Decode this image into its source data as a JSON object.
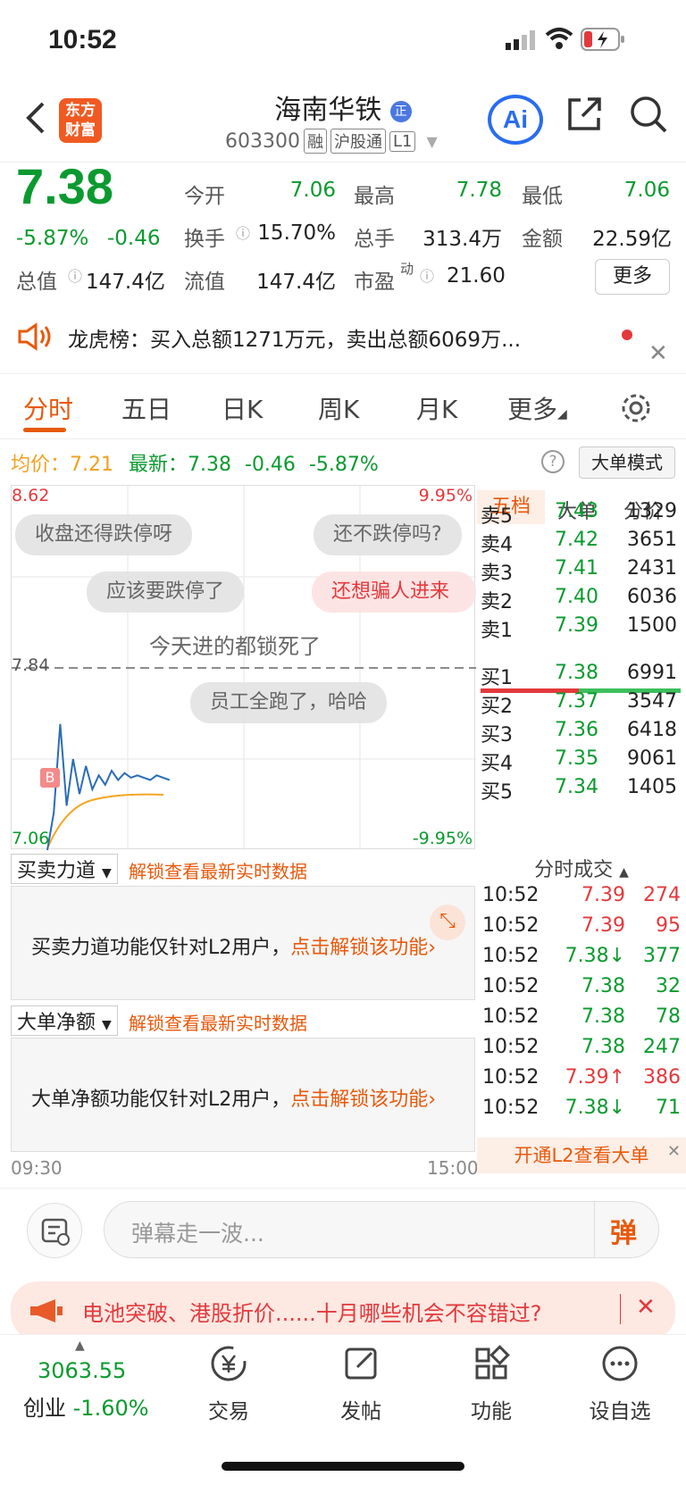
{
  "status": {
    "time": "10:52"
  },
  "header": {
    "logo": "东方财富",
    "stock_name": "海南华铁",
    "code": "603300",
    "tags": [
      "融",
      "沪股通",
      "L1"
    ],
    "ai_label": "Ai"
  },
  "quote": {
    "price": "7.38",
    "change_pct": "-5.87%",
    "change": "-0.46",
    "open_label": "今开",
    "open": "7.06",
    "high_label": "最高",
    "high": "7.78",
    "low_label": "最低",
    "low": "7.06",
    "turnover_label": "换手",
    "turnover": "15.70%",
    "volume_label": "总手",
    "volume": "313.4万",
    "amount_label": "金额",
    "amount": "22.59亿",
    "mktcap_label": "总值",
    "mktcap": "147.4亿",
    "float_label": "流值",
    "float": "147.4亿",
    "pe_label": "市盈",
    "pe_sup": "动",
    "pe": "21.60",
    "more": "更多"
  },
  "notice": {
    "text": "龙虎榜：买入总额1271万元，卖出总额6069万..."
  },
  "tabs": [
    "分时",
    "五日",
    "日K",
    "周K",
    "月K",
    "更多"
  ],
  "info": {
    "avg_label": "均价：",
    "avg": "7.21",
    "latest_label": "最新：",
    "latest": "7.38",
    "chg": "-0.46",
    "pct": "-5.87%",
    "bigmode": "大单模式"
  },
  "chart": {
    "y_max": "8.62",
    "y_min": "7.06",
    "pct_max": "9.95%",
    "pct_min": "-9.95%",
    "ref": "7.84",
    "t_start": "09:30",
    "t_end": "15:00",
    "marker": "B",
    "danmu": [
      "收盘还得跌停呀",
      "还不跌停吗?",
      "应该要跌停了",
      "还想骗人进来",
      "今天进的都锁死了",
      "员工全跑了，哈哈"
    ]
  },
  "chart_data": {
    "type": "line",
    "series": [
      {
        "values": [
          7.06,
          7.22,
          7.6,
          7.25,
          7.45,
          7.3,
          7.42,
          7.32,
          7.38,
          7.34,
          7.4,
          7.36,
          7.39,
          7.37,
          7.38,
          7.37,
          7.36,
          7.38,
          7.37,
          7.36
        ]
      }
    ],
    "ylim": [
      7.06,
      8.62
    ]
  },
  "book": {
    "tabs": [
      "五档",
      "大单",
      "分价"
    ],
    "sells": [
      {
        "l": "卖5",
        "p": "7.43",
        "v": "1329"
      },
      {
        "l": "卖4",
        "p": "7.42",
        "v": "3651"
      },
      {
        "l": "卖3",
        "p": "7.41",
        "v": "2431"
      },
      {
        "l": "卖2",
        "p": "7.40",
        "v": "6036"
      },
      {
        "l": "卖1",
        "p": "7.39",
        "v": "1500"
      }
    ],
    "buys": [
      {
        "l": "买1",
        "p": "7.38",
        "v": "6991"
      },
      {
        "l": "买2",
        "p": "7.37",
        "v": "3547"
      },
      {
        "l": "买3",
        "p": "7.36",
        "v": "6418"
      },
      {
        "l": "买4",
        "p": "7.35",
        "v": "9061"
      },
      {
        "l": "买5",
        "p": "7.34",
        "v": "1405"
      }
    ]
  },
  "panels": {
    "p1_select": "买卖力道",
    "p1_hint": "解锁查看最新实时数据",
    "p1_text": "买卖力道功能仅针对L2用户，",
    "p1_link": "点击解锁该功能",
    "p2_select": "大单净额",
    "p2_hint": "解锁查看最新实时数据",
    "p2_text": "大单净额功能仅针对L2用户，",
    "p2_link": "点击解锁该功能"
  },
  "trades": {
    "title": "分时成交",
    "rows": [
      {
        "t": "10:52",
        "p": "7.39",
        "v": "274",
        "c": "red",
        "a": ""
      },
      {
        "t": "10:52",
        "p": "7.39",
        "v": "95",
        "c": "red",
        "a": ""
      },
      {
        "t": "10:52",
        "p": "7.38↓",
        "v": "377",
        "c": "green",
        "a": ""
      },
      {
        "t": "10:52",
        "p": "7.38",
        "v": "32",
        "c": "green",
        "a": ""
      },
      {
        "t": "10:52",
        "p": "7.38",
        "v": "78",
        "c": "green",
        "a": ""
      },
      {
        "t": "10:52",
        "p": "7.38",
        "v": "247",
        "c": "green",
        "a": ""
      },
      {
        "t": "10:52",
        "p": "7.39↑",
        "v": "386",
        "c": "red",
        "a": ""
      },
      {
        "t": "10:52",
        "p": "7.38↓",
        "v": "71",
        "c": "green",
        "a": ""
      }
    ],
    "l2": "开通L2查看大单"
  },
  "input": {
    "placeholder": "弹幕走一波...",
    "send": "弹"
  },
  "banner": {
    "text": "电池突破、港股折价......十月哪些机会不容错过?"
  },
  "bottom": {
    "index": "3063.55",
    "index_name": "创业",
    "index_pct": "-1.60%",
    "nav": [
      "交易",
      "发帖",
      "功能",
      "设自选"
    ]
  }
}
